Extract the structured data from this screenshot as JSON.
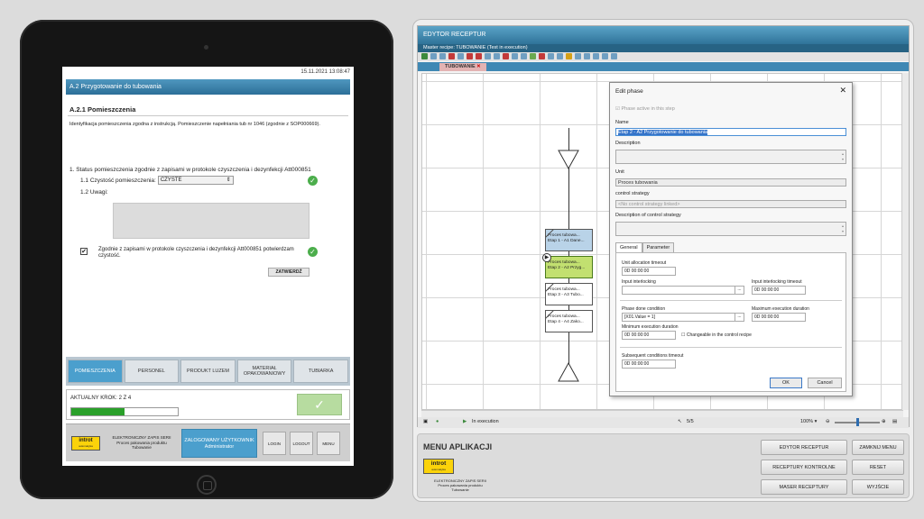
{
  "tablet": {
    "datetime": "15.11.2021 13:08:47",
    "header": "A.2 Przygotowanie do tubowania",
    "section_title": "A.2.1 Pomieszczenia",
    "identification": "Identyfikacja pomieszczenia zgodna z instrukcją. Pomieszczenie napełniania tub nr 1046 (zgodnie z SOP000669).",
    "q1": "1. Status pomieszczenia zgodnie z zapisami w protokole czyszczenia i dezynfekcji Att000851",
    "q11_label": "1.1 Czystość pomieszczenia:",
    "q11_value": "CZYSTE",
    "q12_label": "1.2 Uwagi:",
    "confirm_text": "Zgodnie z zapisami w protokole czyszczenia i dezynfekcji Att000851 potwierdzam czystość.",
    "confirm_button": "ZATWIERDŹ",
    "tabs": [
      "POMIESZCZENIA",
      "PERSONEL",
      "PRODUKT LUZEM",
      "MATERIAŁ OPAKOWANIOWY",
      "TUBIARKA"
    ],
    "step_label": "AKTUALNY KROK:  2 Z 4",
    "progress_fraction": 0.5,
    "logo_text": "introt",
    "logo_sub": "automatyka",
    "system_text": "ELEKTRONICZNY ZAPIS SERII",
    "system_sub": "Proces pakowania produktu",
    "system_sub2": "Tubowanie",
    "user_label": "ZALOGOWANY UŻYTKOWNIK",
    "user_name": "Administrator",
    "login": "LOGIN",
    "logout": "LOGOUT",
    "menu": "MENU"
  },
  "editor": {
    "title": "EDYTOR RECEPTUR",
    "subtitle": "Master recipe: TUBOWANIE (Test in execution)",
    "tab": "TUBOWANIE",
    "steps": [
      {
        "line1": "Proces tubowa...",
        "line2": "Etap 1 - A1 Dane..."
      },
      {
        "line1": "Proces tubowa...",
        "line2": "Etap 2 - A2 Przyg..."
      },
      {
        "line1": "Proces tubowa...",
        "line2": "Etap 3 - A3 Tubo..."
      },
      {
        "line1": "Proces tubowa...",
        "line2": "Etap 4 - A4 Zako..."
      }
    ],
    "status_text": "In execution",
    "page_count": "5/5",
    "zoom": "100% ▾"
  },
  "dialog": {
    "title": "Edit phase",
    "active_label": "Phase active in this step",
    "name_label": "Name",
    "name_value": "Etap 2 - A2 Przygotowanie do tubowania",
    "desc_label": "Description",
    "unit_label": "Unit",
    "unit_value": "Proces tubowania",
    "cs_label": "control strategy",
    "cs_value": "<No control strategy linked>",
    "cs_desc_label": "Description of control strategy",
    "tab_general": "General",
    "tab_parameter": "Parameter",
    "alloc_label": "Unit allocation timeout",
    "alloc_value": "0D 00:00:00",
    "interlock_label": "Input interlocking",
    "interlock_timeout_label": "Input interlocking timeout",
    "interlock_timeout_value": "0D 00:00:00",
    "done_label": "Phase done condition",
    "done_value": "[X01.Value = 1]",
    "max_label": "Maximum execution duration",
    "max_value": "0D 00:00:00",
    "min_label": "Minimum execution duration",
    "min_value": "0D 00:00:00",
    "changeable_label": "Changeable in the control recipe",
    "subseq_label": "Subsequent conditions timeout",
    "subseq_value": "0D 00:00:00",
    "ok": "OK",
    "cancel": "Cancel"
  },
  "menu": {
    "title": "MENU APLIKACJI",
    "logo_text": "introt",
    "logo_sub": "automatyka",
    "system_text": "ELEKTRONICZNY ZAPIS SERII",
    "system_sub": "Proces pakowania produktu",
    "system_sub2": "Tubowanie",
    "buttons": [
      "EDYTOR RECEPTUR",
      "ZAMKNIJ MENU",
      "RECEPTURY KONTROLNE",
      "RESET",
      "MASER RECEPTURY",
      "WYJŚCIE"
    ]
  }
}
